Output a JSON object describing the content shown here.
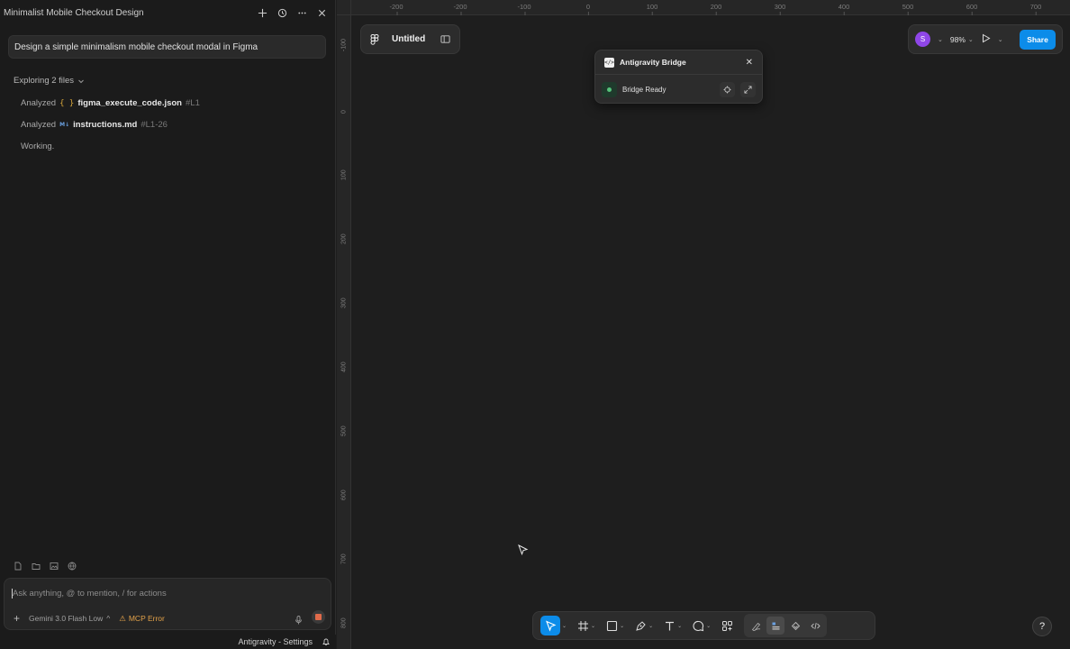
{
  "chat": {
    "title": "Minimalist Mobile Checkout Design",
    "prompt": "Design a simple minimalism mobile checkout modal in Figma",
    "exploring": "Exploring 2 files",
    "steps": [
      {
        "verb": "Analyzed",
        "icon": "{ }",
        "file": "figma_execute_code.json",
        "lines": "#L1"
      },
      {
        "verb": "Analyzed",
        "icon": "M↓",
        "file": "instructions.md",
        "lines": "#L1-26"
      }
    ],
    "working": "Working.",
    "composer": {
      "placeholder": "Ask anything, @ to mention, / for actions",
      "plus": "+",
      "model": "Gemini 3.0 Flash Low",
      "model_caret": "^",
      "mcp_error": "MCP Error",
      "warning_glyph": "⚠"
    },
    "status_bar": {
      "settings": "Antigravity - Settings"
    }
  },
  "canvas": {
    "ruler_top": [
      "-200",
      "-200",
      "-100",
      "0",
      "100",
      "200",
      "300",
      "400",
      "500",
      "600",
      "700"
    ],
    "ruler_left": [
      "-100",
      "0",
      "100",
      "200",
      "300",
      "400",
      "500",
      "600",
      "700",
      "800"
    ],
    "file_name": "Untitled",
    "avatar_letter": "S",
    "zoom": "98%",
    "chevron": "⌄",
    "share": "Share",
    "plugin": {
      "title": "Antigravity Bridge",
      "logo": "</>",
      "close": "✕",
      "status": "Bridge Ready"
    },
    "help": "?",
    "colors": {
      "accent": "#0c8ce9",
      "avatar": "#8f46e8",
      "ready": "#55c27a",
      "mcp_error": "#e3a24a"
    }
  }
}
